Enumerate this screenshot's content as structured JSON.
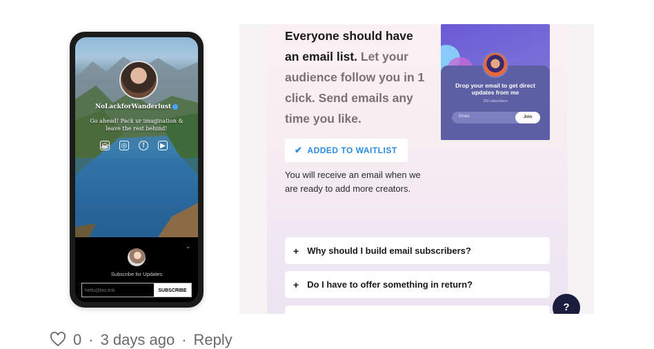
{
  "phone": {
    "profile_name": "NoLackforWanderlust",
    "bio": "Go ahead! Pack ur imagination & leave the rest behind!",
    "social_icons": [
      "cup-icon",
      "instagram-icon",
      "facebook-icon",
      "youtube-icon"
    ],
    "subscribe_text": "Subscribe for Updates",
    "email_placeholder": "hello@bio.link",
    "subscribe_button": "SUBSCRIBE"
  },
  "panel": {
    "headline_strong": "Everyone should have an email list.",
    "headline_muted": "Let your audience follow you in 1 click. Send emails any time you like.",
    "waitlist_button": "ADDED TO WAITLIST",
    "note": "You will receive an email when we are ready to add more creators.",
    "preview": {
      "title": "Drop your email to get direct updates from me",
      "subscribers": "250 subscribers",
      "email_placeholder": "Email",
      "join_button": "Join"
    },
    "faq": [
      "Why should I build email subscribers?",
      "Do I have to offer something in return?"
    ],
    "help_button": "?"
  },
  "comment_bar": {
    "likes": "0",
    "time": "3 days ago",
    "reply": "Reply"
  },
  "colors": {
    "accent_blue": "#2b8ae6",
    "help_bg": "#1a1e3c",
    "preview_purple": "#6a5ad6"
  }
}
